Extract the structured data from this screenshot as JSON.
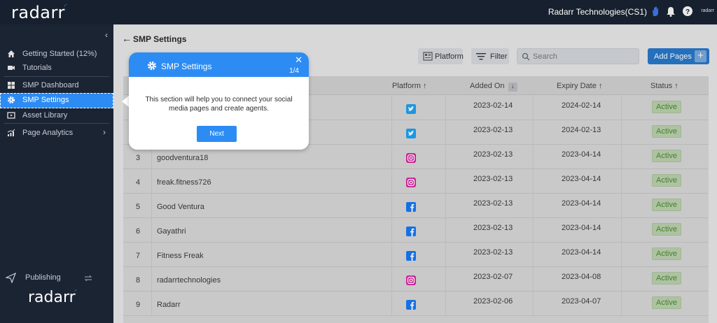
{
  "header": {
    "logo_text": "radarr",
    "org_name": "Radarr Technologies(CS1)",
    "mini_logo": "radarr"
  },
  "sidebar": {
    "items": [
      {
        "label": "Getting Started (12%)",
        "icon": "home-icon"
      },
      {
        "label": "Tutorials",
        "icon": "video-icon"
      },
      {
        "label": "SMP Dashboard",
        "icon": "grid-icon"
      },
      {
        "label": "SMP Settings",
        "icon": "gear-icon",
        "active": true
      },
      {
        "label": "Asset Library",
        "icon": "library-icon"
      },
      {
        "label": "Page Analytics",
        "icon": "analytics-icon"
      }
    ],
    "publishing_label": "Publishing",
    "bottom_logo": "radarr"
  },
  "main": {
    "title": "SMP Settings",
    "platform_label": "Platform",
    "filter_label": "Filter",
    "search_placeholder": "Search",
    "add_pages_label": "Add Pages",
    "columns": {
      "platform": "Platform ↑",
      "added_on": "Added On",
      "expiry": "Expiry Date ↑",
      "status": "Status ↑"
    },
    "rows": [
      {
        "no": "",
        "name": "",
        "platform": "twitter",
        "added": "2023-02-14",
        "expiry": "2024-02-14",
        "status": "Active"
      },
      {
        "no": "",
        "name": "",
        "platform": "twitter",
        "added": "2023-02-13",
        "expiry": "2024-02-13",
        "status": "Active"
      },
      {
        "no": "3",
        "name": "goodventura18",
        "platform": "instagram",
        "added": "2023-02-13",
        "expiry": "2023-04-14",
        "status": "Active"
      },
      {
        "no": "4",
        "name": "freak.fitness726",
        "platform": "instagram",
        "added": "2023-02-13",
        "expiry": "2023-04-14",
        "status": "Active"
      },
      {
        "no": "5",
        "name": "Good Ventura",
        "platform": "facebook",
        "added": "2023-02-13",
        "expiry": "2023-04-14",
        "status": "Active"
      },
      {
        "no": "6",
        "name": "Gayathri",
        "platform": "facebook",
        "added": "2023-02-13",
        "expiry": "2023-04-14",
        "status": "Active"
      },
      {
        "no": "7",
        "name": "Fitness Freak",
        "platform": "facebook",
        "added": "2023-02-13",
        "expiry": "2023-04-14",
        "status": "Active"
      },
      {
        "no": "8",
        "name": "radarrtechnologies",
        "platform": "instagram",
        "added": "2023-02-07",
        "expiry": "2023-04-08",
        "status": "Active"
      },
      {
        "no": "9",
        "name": "Radarr",
        "platform": "facebook",
        "added": "2023-02-06",
        "expiry": "2023-04-07",
        "status": "Active"
      }
    ]
  },
  "tooltip": {
    "title": "SMP Settings",
    "step": "1/4",
    "body": "This section will help you to connect your social media pages and create agents.",
    "next_label": "Next"
  },
  "colors": {
    "accent": "#2c8cf4",
    "twitter": "#1da1f2",
    "facebook": "#1877f2",
    "instagram": "#d6249f",
    "active_text": "#4a8a2f"
  }
}
